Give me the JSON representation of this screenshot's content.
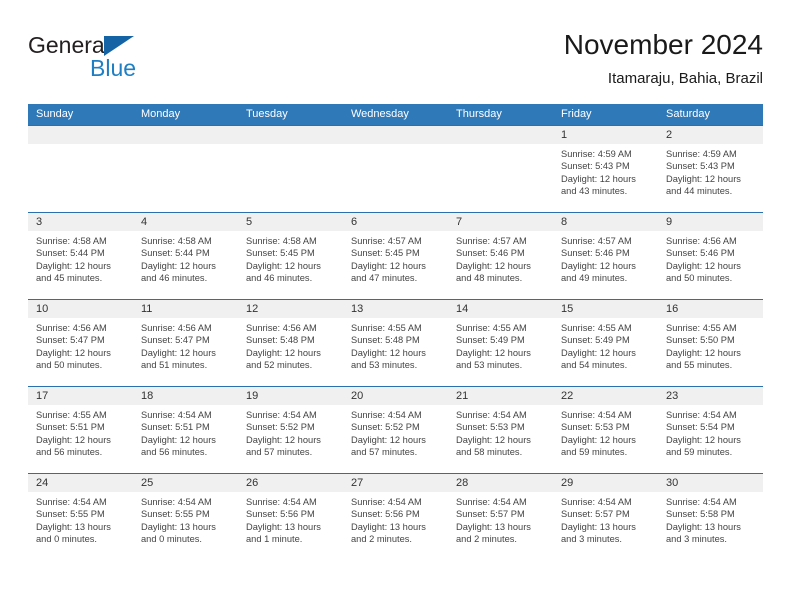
{
  "brand": {
    "name_top": "General",
    "name_bottom": "Blue",
    "color_dark": "#231f20",
    "color_blue": "#1f7fc4"
  },
  "header": {
    "title": "November 2024",
    "subtitle": "Itamaraju, Bahia, Brazil"
  },
  "theme": {
    "header_bg": "#3079b8",
    "row_divider": "#2c6fae",
    "day_band_bg": "#f0f0f0"
  },
  "calendar": {
    "weekdays": [
      "Sunday",
      "Monday",
      "Tuesday",
      "Wednesday",
      "Thursday",
      "Friday",
      "Saturday"
    ],
    "labels": {
      "sunrise": "Sunrise:",
      "sunset": "Sunset:",
      "daylight": "Daylight:"
    },
    "weeks": [
      [
        {
          "day": "",
          "empty": true
        },
        {
          "day": "",
          "empty": true
        },
        {
          "day": "",
          "empty": true
        },
        {
          "day": "",
          "empty": true
        },
        {
          "day": "",
          "empty": true
        },
        {
          "day": "1",
          "sunrise": "Sunrise: 4:59 AM",
          "sunset": "Sunset: 5:43 PM",
          "daylight_1": "Daylight: 12 hours",
          "daylight_2": "and 43 minutes."
        },
        {
          "day": "2",
          "sunrise": "Sunrise: 4:59 AM",
          "sunset": "Sunset: 5:43 PM",
          "daylight_1": "Daylight: 12 hours",
          "daylight_2": "and 44 minutes."
        }
      ],
      [
        {
          "day": "3",
          "sunrise": "Sunrise: 4:58 AM",
          "sunset": "Sunset: 5:44 PM",
          "daylight_1": "Daylight: 12 hours",
          "daylight_2": "and 45 minutes."
        },
        {
          "day": "4",
          "sunrise": "Sunrise: 4:58 AM",
          "sunset": "Sunset: 5:44 PM",
          "daylight_1": "Daylight: 12 hours",
          "daylight_2": "and 46 minutes."
        },
        {
          "day": "5",
          "sunrise": "Sunrise: 4:58 AM",
          "sunset": "Sunset: 5:45 PM",
          "daylight_1": "Daylight: 12 hours",
          "daylight_2": "and 46 minutes."
        },
        {
          "day": "6",
          "sunrise": "Sunrise: 4:57 AM",
          "sunset": "Sunset: 5:45 PM",
          "daylight_1": "Daylight: 12 hours",
          "daylight_2": "and 47 minutes."
        },
        {
          "day": "7",
          "sunrise": "Sunrise: 4:57 AM",
          "sunset": "Sunset: 5:46 PM",
          "daylight_1": "Daylight: 12 hours",
          "daylight_2": "and 48 minutes."
        },
        {
          "day": "8",
          "sunrise": "Sunrise: 4:57 AM",
          "sunset": "Sunset: 5:46 PM",
          "daylight_1": "Daylight: 12 hours",
          "daylight_2": "and 49 minutes."
        },
        {
          "day": "9",
          "sunrise": "Sunrise: 4:56 AM",
          "sunset": "Sunset: 5:46 PM",
          "daylight_1": "Daylight: 12 hours",
          "daylight_2": "and 50 minutes."
        }
      ],
      [
        {
          "day": "10",
          "sunrise": "Sunrise: 4:56 AM",
          "sunset": "Sunset: 5:47 PM",
          "daylight_1": "Daylight: 12 hours",
          "daylight_2": "and 50 minutes."
        },
        {
          "day": "11",
          "sunrise": "Sunrise: 4:56 AM",
          "sunset": "Sunset: 5:47 PM",
          "daylight_1": "Daylight: 12 hours",
          "daylight_2": "and 51 minutes."
        },
        {
          "day": "12",
          "sunrise": "Sunrise: 4:56 AM",
          "sunset": "Sunset: 5:48 PM",
          "daylight_1": "Daylight: 12 hours",
          "daylight_2": "and 52 minutes."
        },
        {
          "day": "13",
          "sunrise": "Sunrise: 4:55 AM",
          "sunset": "Sunset: 5:48 PM",
          "daylight_1": "Daylight: 12 hours",
          "daylight_2": "and 53 minutes."
        },
        {
          "day": "14",
          "sunrise": "Sunrise: 4:55 AM",
          "sunset": "Sunset: 5:49 PM",
          "daylight_1": "Daylight: 12 hours",
          "daylight_2": "and 53 minutes."
        },
        {
          "day": "15",
          "sunrise": "Sunrise: 4:55 AM",
          "sunset": "Sunset: 5:49 PM",
          "daylight_1": "Daylight: 12 hours",
          "daylight_2": "and 54 minutes."
        },
        {
          "day": "16",
          "sunrise": "Sunrise: 4:55 AM",
          "sunset": "Sunset: 5:50 PM",
          "daylight_1": "Daylight: 12 hours",
          "daylight_2": "and 55 minutes."
        }
      ],
      [
        {
          "day": "17",
          "sunrise": "Sunrise: 4:55 AM",
          "sunset": "Sunset: 5:51 PM",
          "daylight_1": "Daylight: 12 hours",
          "daylight_2": "and 56 minutes."
        },
        {
          "day": "18",
          "sunrise": "Sunrise: 4:54 AM",
          "sunset": "Sunset: 5:51 PM",
          "daylight_1": "Daylight: 12 hours",
          "daylight_2": "and 56 minutes."
        },
        {
          "day": "19",
          "sunrise": "Sunrise: 4:54 AM",
          "sunset": "Sunset: 5:52 PM",
          "daylight_1": "Daylight: 12 hours",
          "daylight_2": "and 57 minutes."
        },
        {
          "day": "20",
          "sunrise": "Sunrise: 4:54 AM",
          "sunset": "Sunset: 5:52 PM",
          "daylight_1": "Daylight: 12 hours",
          "daylight_2": "and 57 minutes."
        },
        {
          "day": "21",
          "sunrise": "Sunrise: 4:54 AM",
          "sunset": "Sunset: 5:53 PM",
          "daylight_1": "Daylight: 12 hours",
          "daylight_2": "and 58 minutes."
        },
        {
          "day": "22",
          "sunrise": "Sunrise: 4:54 AM",
          "sunset": "Sunset: 5:53 PM",
          "daylight_1": "Daylight: 12 hours",
          "daylight_2": "and 59 minutes."
        },
        {
          "day": "23",
          "sunrise": "Sunrise: 4:54 AM",
          "sunset": "Sunset: 5:54 PM",
          "daylight_1": "Daylight: 12 hours",
          "daylight_2": "and 59 minutes."
        }
      ],
      [
        {
          "day": "24",
          "sunrise": "Sunrise: 4:54 AM",
          "sunset": "Sunset: 5:55 PM",
          "daylight_1": "Daylight: 13 hours",
          "daylight_2": "and 0 minutes."
        },
        {
          "day": "25",
          "sunrise": "Sunrise: 4:54 AM",
          "sunset": "Sunset: 5:55 PM",
          "daylight_1": "Daylight: 13 hours",
          "daylight_2": "and 0 minutes."
        },
        {
          "day": "26",
          "sunrise": "Sunrise: 4:54 AM",
          "sunset": "Sunset: 5:56 PM",
          "daylight_1": "Daylight: 13 hours",
          "daylight_2": "and 1 minute."
        },
        {
          "day": "27",
          "sunrise": "Sunrise: 4:54 AM",
          "sunset": "Sunset: 5:56 PM",
          "daylight_1": "Daylight: 13 hours",
          "daylight_2": "and 2 minutes."
        },
        {
          "day": "28",
          "sunrise": "Sunrise: 4:54 AM",
          "sunset": "Sunset: 5:57 PM",
          "daylight_1": "Daylight: 13 hours",
          "daylight_2": "and 2 minutes."
        },
        {
          "day": "29",
          "sunrise": "Sunrise: 4:54 AM",
          "sunset": "Sunset: 5:57 PM",
          "daylight_1": "Daylight: 13 hours",
          "daylight_2": "and 3 minutes."
        },
        {
          "day": "30",
          "sunrise": "Sunrise: 4:54 AM",
          "sunset": "Sunset: 5:58 PM",
          "daylight_1": "Daylight: 13 hours",
          "daylight_2": "and 3 minutes."
        }
      ]
    ]
  }
}
